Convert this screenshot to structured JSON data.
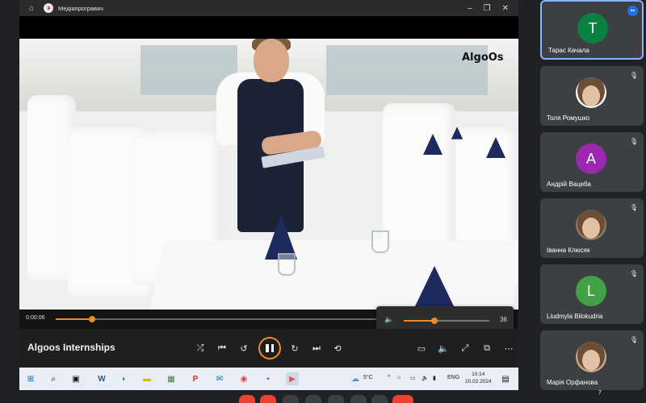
{
  "window": {
    "title": "Медіапрогравач"
  },
  "video": {
    "logo_text": "AlgoOs",
    "elapsed": "0:00:06",
    "progress_fraction": 0.11,
    "volume": "36",
    "volume_fraction": 0.36
  },
  "player": {
    "media_title": "Algoos Internships"
  },
  "taskbar": {
    "weather_temp": "5°C",
    "language": "ENG",
    "time": "10:14",
    "date": "20.02.2024"
  },
  "participants": [
    {
      "name": "Тарас Качала",
      "initial": "T",
      "color": "#0b8043",
      "speaking": true,
      "type": "letter"
    },
    {
      "name": "Толя Ромушко",
      "initial": "",
      "color": "#ffffff",
      "speaking": false,
      "type": "photo"
    },
    {
      "name": "Андрій Вацеба",
      "initial": "A",
      "color": "#9c27b0",
      "speaking": false,
      "type": "letter"
    },
    {
      "name": "Іванна Клюсяк",
      "initial": "",
      "color": "#8d7b68",
      "speaking": false,
      "type": "photo"
    },
    {
      "name": "Liudmyla Bilokudria",
      "initial": "L",
      "color": "#43a047",
      "speaking": false,
      "type": "letter"
    },
    {
      "name": "Марія Орфанова",
      "initial": "",
      "color": "#c9a98a",
      "speaking": false,
      "type": "photo"
    }
  ],
  "meeting": {
    "participant_count": "7"
  },
  "icons": {
    "home": "home-icon",
    "shuffle": "shuffle-icon",
    "previous": "previous-icon",
    "rewind": "rewind-10-icon",
    "pause": "pause-icon",
    "forward": "forward-30-icon",
    "next": "next-icon",
    "repeat": "repeat-off-icon",
    "captions": "captions-icon",
    "volume": "volume-icon",
    "fullscreen": "fullscreen-icon",
    "miniplayer": "miniplayer-icon",
    "more": "more-icon"
  },
  "colors": {
    "accent": "#f08a24",
    "meet_bg": "#202124",
    "tile_bg": "#3c4043"
  }
}
